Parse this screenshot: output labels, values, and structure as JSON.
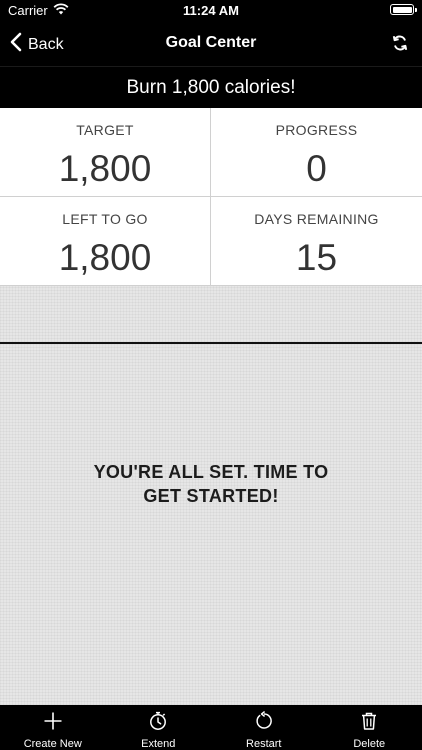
{
  "status_bar": {
    "carrier": "Carrier",
    "time": "11:24 AM"
  },
  "nav": {
    "back_label": "Back",
    "title": "Goal Center"
  },
  "goal": {
    "title": "Burn 1,800 calories!"
  },
  "stats": [
    {
      "label": "TARGET",
      "value": "1,800"
    },
    {
      "label": "PROGRESS",
      "value": "0"
    },
    {
      "label": "LEFT TO GO",
      "value": "1,800"
    },
    {
      "label": "DAYS REMAINING",
      "value": "15"
    }
  ],
  "message": {
    "line1": "YOU'RE ALL SET. TIME TO",
    "line2": "GET STARTED!"
  },
  "tabs": [
    {
      "label": "Create New",
      "icon": "plus-icon"
    },
    {
      "label": "Extend",
      "icon": "stopwatch-icon"
    },
    {
      "label": "Restart",
      "icon": "restart-icon"
    },
    {
      "label": "Delete",
      "icon": "trash-icon"
    }
  ],
  "colors": {
    "bar_background": "#000000",
    "texture_background": "#e6e6e6",
    "card_background": "#ffffff"
  }
}
